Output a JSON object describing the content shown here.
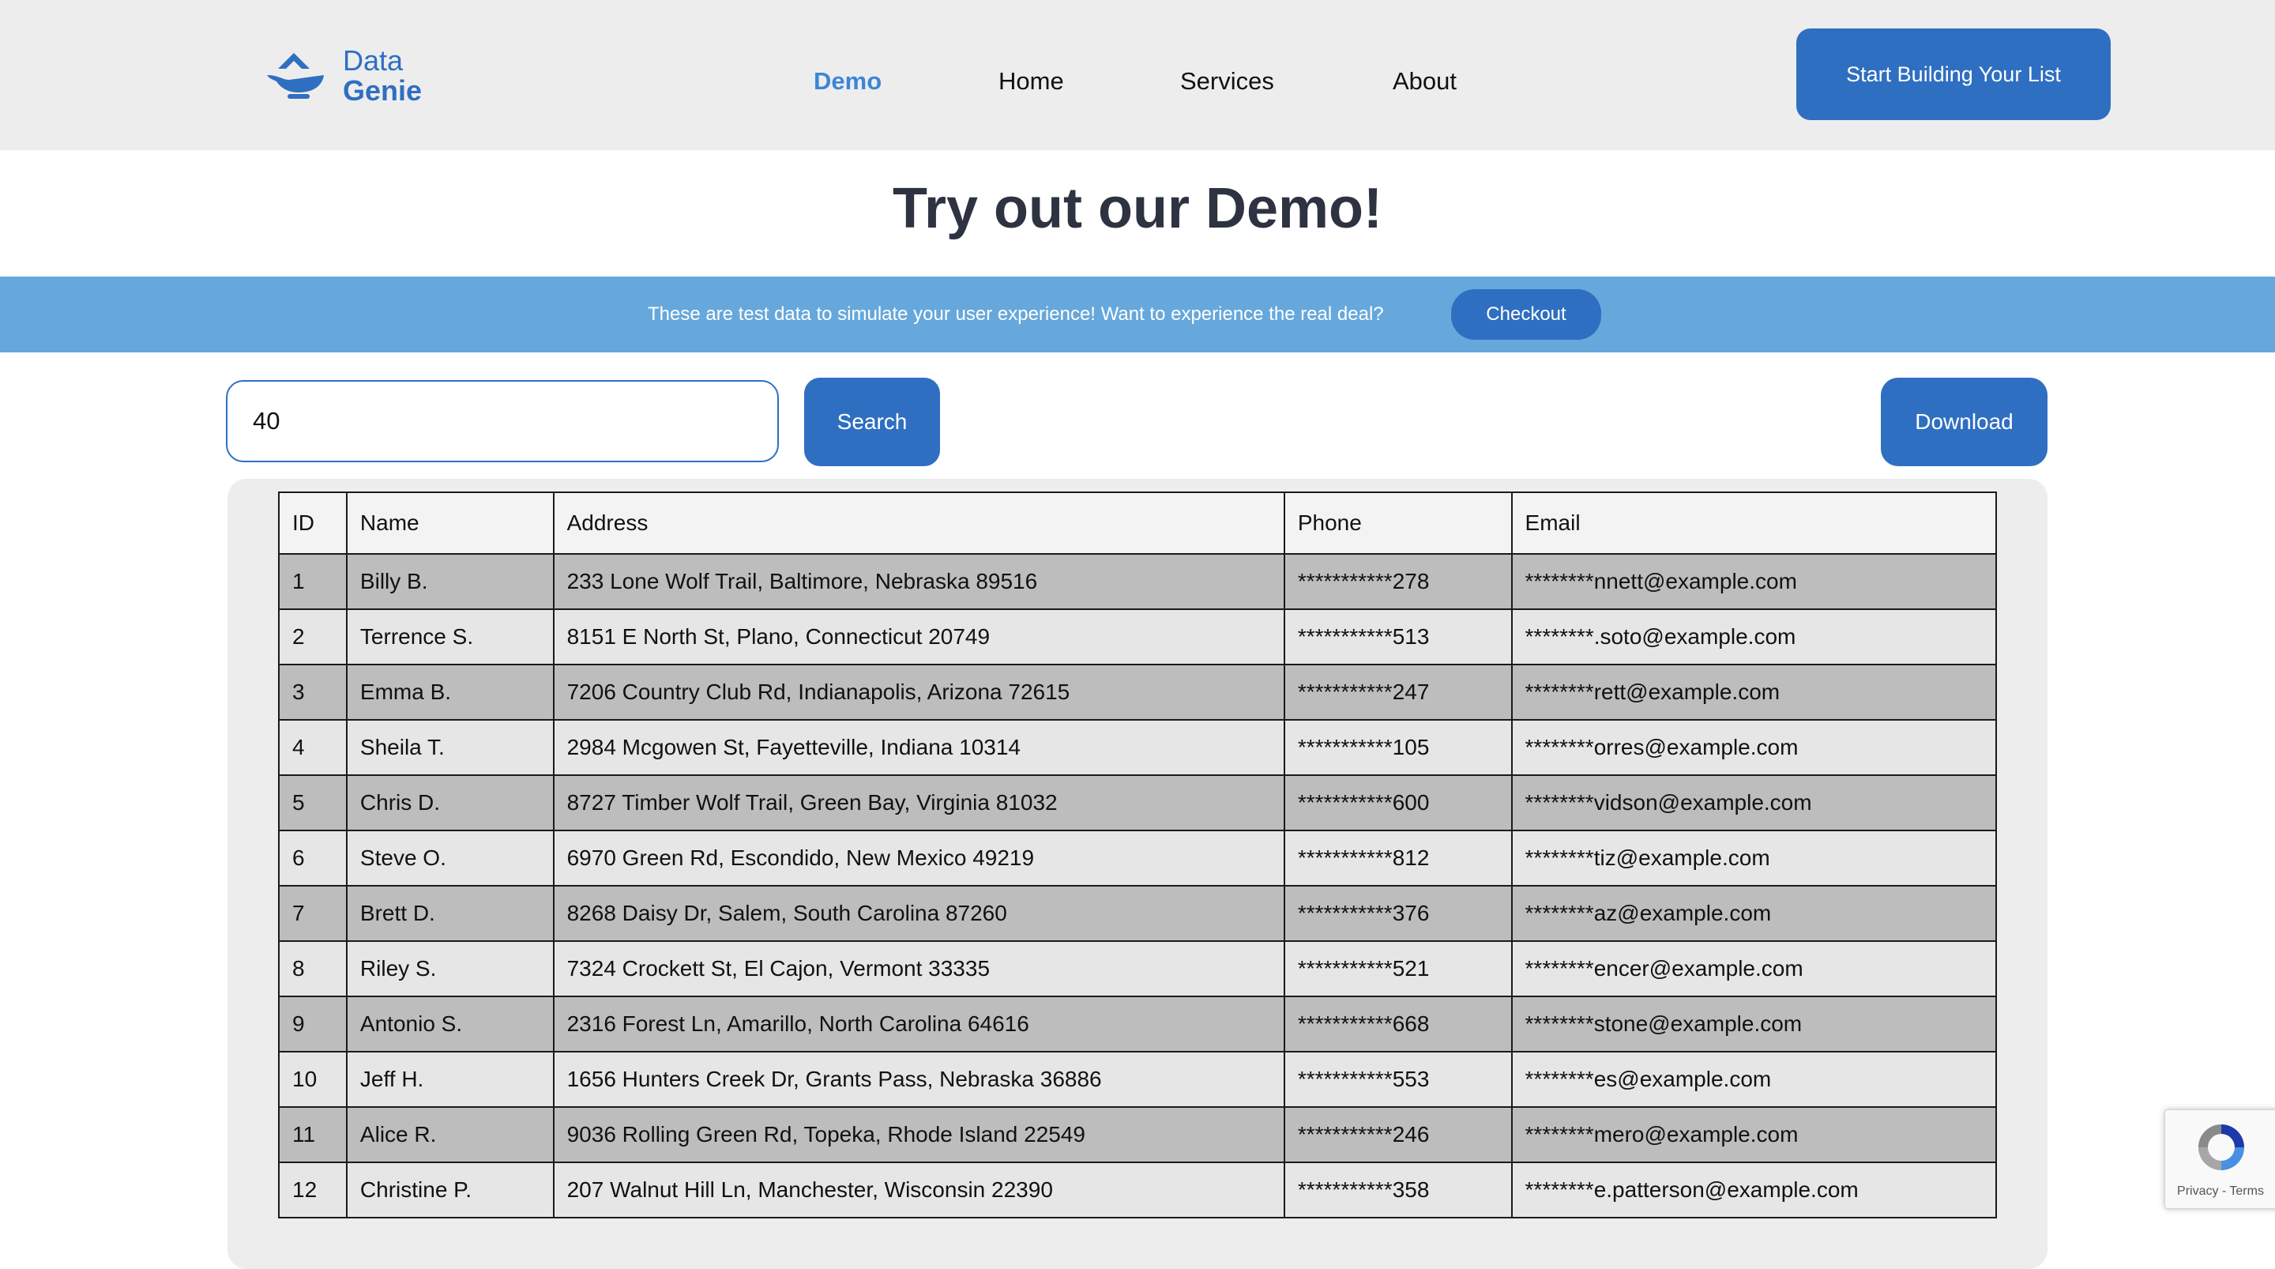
{
  "header": {
    "logo": {
      "word1": "Data",
      "word2": "Genie"
    },
    "nav": [
      {
        "label": "Demo",
        "active": true
      },
      {
        "label": "Home"
      },
      {
        "label": "Services"
      },
      {
        "label": "About"
      }
    ],
    "cta_label": "Start Building Your List"
  },
  "page": {
    "title": "Try out our Demo!"
  },
  "banner": {
    "text": "These are test data to simulate your user experience! Want to experience the real deal?",
    "button_label": "Checkout"
  },
  "search": {
    "value": "40",
    "button_label": "Search"
  },
  "download_label": "Download",
  "table": {
    "columns": [
      "ID",
      "Name",
      "Address",
      "Phone",
      "Email"
    ],
    "rows": [
      [
        "1",
        "Billy B.",
        "233 Lone Wolf Trail, Baltimore, Nebraska 89516",
        "***********278",
        "********nnett@example.com"
      ],
      [
        "2",
        "Terrence S.",
        "8151 E North St, Plano, Connecticut 20749",
        "***********513",
        "********.soto@example.com"
      ],
      [
        "3",
        "Emma B.",
        "7206 Country Club Rd, Indianapolis, Arizona 72615",
        "***********247",
        "********rett@example.com"
      ],
      [
        "4",
        "Sheila T.",
        "2984 Mcgowen St, Fayetteville, Indiana 10314",
        "***********105",
        "********orres@example.com"
      ],
      [
        "5",
        "Chris D.",
        "8727 Timber Wolf Trail, Green Bay, Virginia 81032",
        "***********600",
        "********vidson@example.com"
      ],
      [
        "6",
        "Steve O.",
        "6970 Green Rd, Escondido, New Mexico 49219",
        "***********812",
        "********tiz@example.com"
      ],
      [
        "7",
        "Brett D.",
        "8268 Daisy Dr, Salem, South Carolina 87260",
        "***********376",
        "********az@example.com"
      ],
      [
        "8",
        "Riley S.",
        "7324 Crockett St, El Cajon, Vermont 33335",
        "***********521",
        "********encer@example.com"
      ],
      [
        "9",
        "Antonio S.",
        "2316 Forest Ln, Amarillo, North Carolina 64616",
        "***********668",
        "********stone@example.com"
      ],
      [
        "10",
        "Jeff H.",
        "1656 Hunters Creek Dr, Grants Pass, Nebraska 36886",
        "***********553",
        "********es@example.com"
      ],
      [
        "11",
        "Alice R.",
        "9036 Rolling Green Rd, Topeka, Rhode Island 22549",
        "***********246",
        "********mero@example.com"
      ],
      [
        "12",
        "Christine P.",
        "207 Walnut Hill Ln, Manchester, Wisconsin 22390",
        "***********358",
        "********e.patterson@example.com"
      ]
    ]
  },
  "recaptcha": {
    "privacy": "Privacy",
    "separator": " - ",
    "terms": "Terms"
  },
  "colors": {
    "brand_blue": "#2f6fc1",
    "nav_active": "#3d86d3",
    "banner": "#66a8dc",
    "header_bg": "#ededee",
    "row_dark": "#bdbdbd",
    "row_light": "#e6e6e6"
  },
  "icons": {
    "logo": "genie-lamp-icon",
    "recaptcha": "recaptcha-icon"
  }
}
